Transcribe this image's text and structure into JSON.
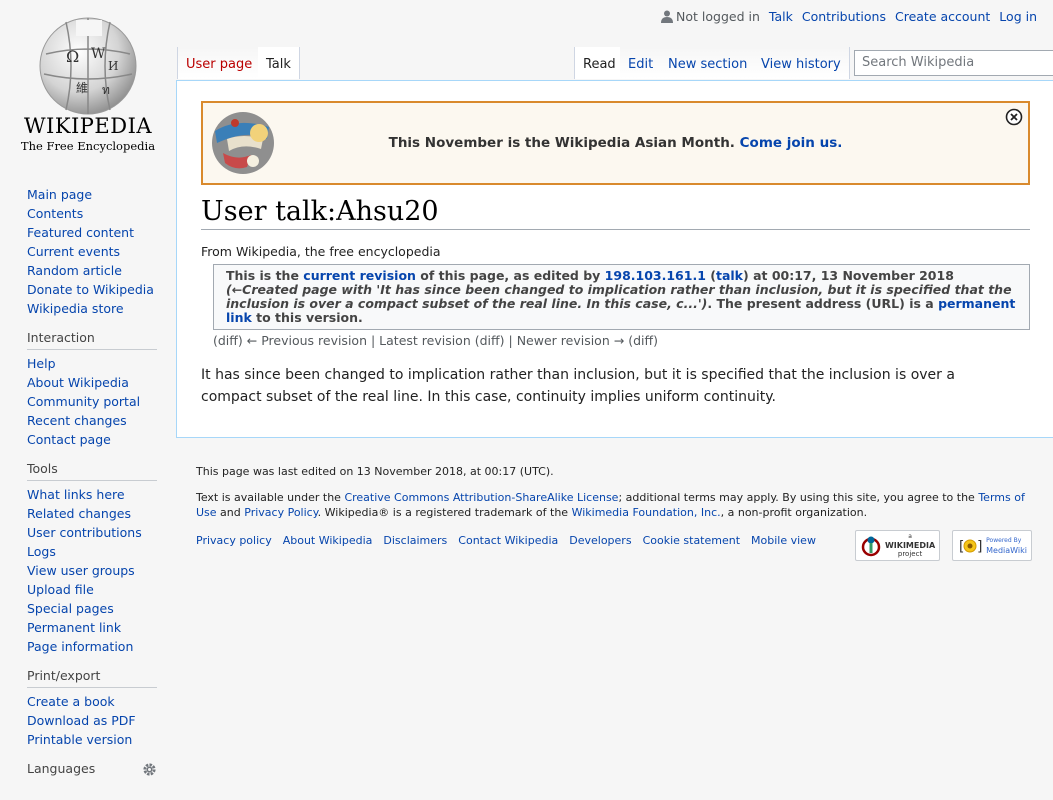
{
  "logo": {
    "wordmark": "Wikipedia",
    "tagline": "The Free Encyclopedia",
    "icon": "wikipedia-globe-logo"
  },
  "personal_tools": {
    "not_logged_in": "Not logged in",
    "talk": "Talk",
    "contributions": "Contributions",
    "create_account": "Create account",
    "log_in": "Log in",
    "user_icon": "user-icon"
  },
  "tabs": {
    "user_page": "User page",
    "talk": "Talk",
    "read": "Read",
    "edit": "Edit",
    "new_section": "New section",
    "view_history": "View history"
  },
  "search": {
    "placeholder": "Search Wikipedia"
  },
  "navigation": {
    "items": [
      "Main page",
      "Contents",
      "Featured content",
      "Current events",
      "Random article",
      "Donate to Wikipedia",
      "Wikipedia store"
    ]
  },
  "interaction": {
    "heading": "Interaction",
    "items": [
      "Help",
      "About Wikipedia",
      "Community portal",
      "Recent changes",
      "Contact page"
    ]
  },
  "tools": {
    "heading": "Tools",
    "items": [
      "What links here",
      "Related changes",
      "User contributions",
      "Logs",
      "View user groups",
      "Upload file",
      "Special pages",
      "Permanent link",
      "Page information"
    ]
  },
  "print_export": {
    "heading": "Print/export",
    "items": [
      "Create a book",
      "Download as PDF",
      "Printable version"
    ]
  },
  "languages": {
    "heading": "Languages",
    "icon": "gear-icon"
  },
  "banner": {
    "message": "This November is the Wikipedia Asian Month.",
    "link": "Come join us.",
    "close_icon": "close-icon"
  },
  "page": {
    "title": "User talk:Ahsu20",
    "site_sub": "From Wikipedia, the free encyclopedia"
  },
  "revision": {
    "prefix": "This is the ",
    "current_revision": "current revision",
    "of_page": " of this page, as edited by ",
    "editor": "198.103.161.1",
    "open_paren": " (",
    "talk": "talk",
    "at": ") at 00:17, 13 November 2018 ",
    "summary": "(←Created page with 'It has since been changed to implication rather than inclusion, but it is specified that the inclusion is over a compact subset of the real line. In this case, c...')",
    "present": ". The present address (URL) is a ",
    "permanent_link": "permanent link",
    "to_version": " to this version."
  },
  "revision_nav": {
    "diff1": "(diff)",
    "prev": "← Previous revision",
    "sep1": " | ",
    "latest": "Latest revision",
    "diff2": "(diff)",
    "sep2": " | ",
    "newer": "Newer revision →",
    "diff3": "(diff)"
  },
  "body_text": "It has since been changed to implication rather than inclusion, but it is specified that the inclusion is over a compact subset of the real line. In this case, continuity implies uniform continuity.",
  "footer": {
    "last_edited": "This page was last edited on 13 November 2018, at 00:17 (UTC).",
    "license_pre": "Text is available under the ",
    "license_link": "Creative Commons Attribution-ShareAlike License",
    "license_mid": "; additional terms may apply. By using this site, you agree to the ",
    "terms": "Terms of Use",
    "and": " and ",
    "privacy": "Privacy Policy",
    "trademark": ". Wikipedia® is a registered trademark of the ",
    "foundation": "Wikimedia Foundation, Inc.",
    "nonprofit": ", a non-profit organization.",
    "places": [
      "Privacy policy",
      "About Wikipedia",
      "Disclaimers",
      "Contact Wikipedia",
      "Developers",
      "Cookie statement",
      "Mobile view"
    ],
    "wikimedia_badge": {
      "small": "a",
      "name": "WIKIMEDIA",
      "sub": "project"
    },
    "mediawiki_badge": {
      "small": "Powered By",
      "name": "MediaWiki"
    }
  }
}
